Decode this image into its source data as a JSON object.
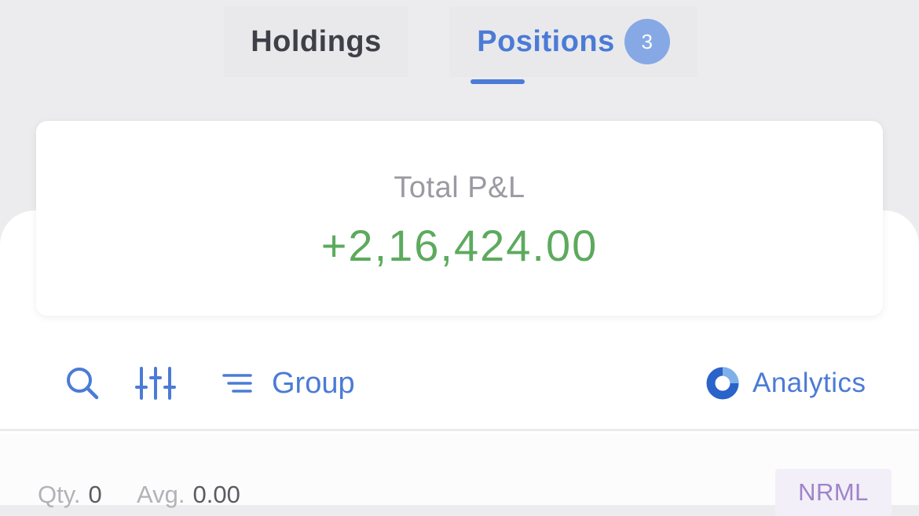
{
  "tabs": {
    "holdings_label": "Holdings",
    "positions_label": "Positions",
    "positions_count": "3",
    "active": "positions"
  },
  "summary": {
    "pnl_label": "Total P&L",
    "pnl_value": "+2,16,424.00"
  },
  "toolbar": {
    "search_icon": "search-icon",
    "filter_icon": "sliders-icon",
    "group_icon": "list-icon",
    "group_label": "Group",
    "analytics_icon": "donut-chart-icon",
    "analytics_label": "Analytics"
  },
  "position": {
    "qty_label": "Qty.",
    "qty_value": "0",
    "avg_label": "Avg.",
    "avg_value": "0.00",
    "product": "NRML"
  },
  "colors": {
    "accent": "#4b7bd6",
    "profit": "#5daa5e",
    "badge_bg": "#86a9e5",
    "product_text": "#9f84c9"
  }
}
